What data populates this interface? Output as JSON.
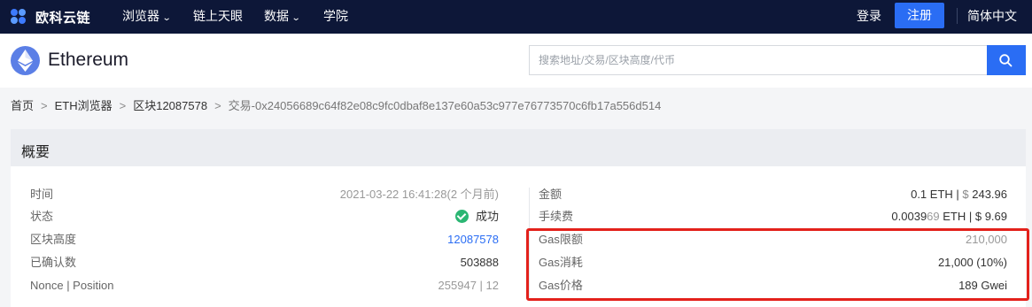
{
  "nav": {
    "logo_text": "欧科云链",
    "items": [
      {
        "label": "浏览器",
        "has_caret": true
      },
      {
        "label": "链上天眼",
        "has_caret": false
      },
      {
        "label": "数据",
        "has_caret": true
      },
      {
        "label": "学院",
        "has_caret": false
      }
    ],
    "login": "登录",
    "register": "注册",
    "language": "简体中文"
  },
  "header": {
    "chain_name": "Ethereum",
    "search_placeholder": "搜索地址/交易/区块高度/代币"
  },
  "breadcrumb": {
    "items": [
      "首页",
      "ETH浏览器",
      "区块12087578"
    ],
    "current": "交易-0x24056689c64f82e08c9fc0dbaf8e137e60a53c977e76773570c6fb17a556d514",
    "separator": ">"
  },
  "overview": {
    "title": "概要",
    "left": [
      {
        "label": "时间",
        "value": "2021-03-22 16:41:28(2 个月前)"
      },
      {
        "label": "状态",
        "value": "成功"
      },
      {
        "label": "区块高度",
        "value": "12087578"
      },
      {
        "label": "已确认数",
        "value": "503888"
      },
      {
        "label": "Nonce | Position",
        "value": "255947 | 12"
      }
    ],
    "right": [
      {
        "label": "金额",
        "value_main": "0.1 ETH |",
        "value_dim": " $",
        "value_tail": " 243.96"
      },
      {
        "label": "手续费",
        "value_main": "0.0039",
        "value_dim": "69",
        "value_tail": " ETH | $ 9.69"
      },
      {
        "label": "Gas限额",
        "value": "210,000"
      },
      {
        "label": "Gas消耗",
        "value": "21,000 (10%)"
      },
      {
        "label": "Gas价格",
        "value": "189 Gwei"
      }
    ]
  },
  "colors": {
    "nav_bg": "#0d1738",
    "accent": "#2a6df4",
    "success": "#2bb673",
    "highlight": "#e3211b"
  }
}
